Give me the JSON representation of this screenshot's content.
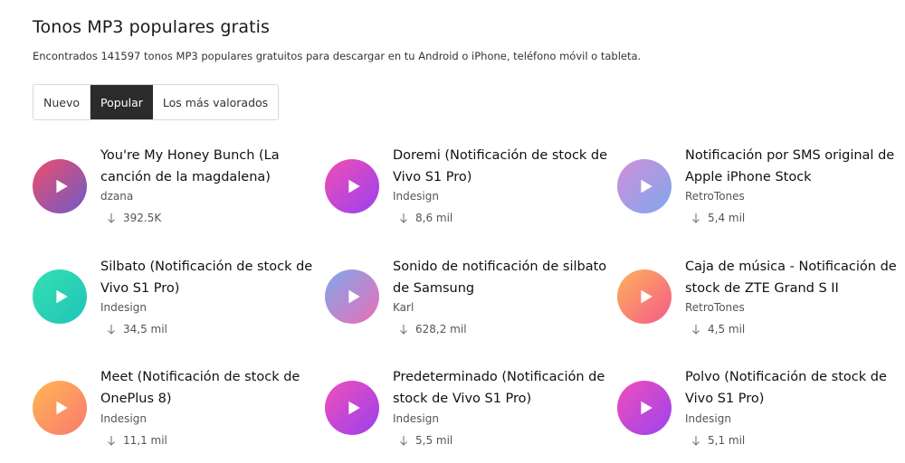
{
  "header": {
    "title": "Tonos MP3 populares gratis",
    "subtitle": "Encontrados 141597 tonos MP3 populares gratuitos para descargar en tu Android o iPhone, teléfono móvil o tableta."
  },
  "tabs": [
    {
      "label": "Nuevo",
      "active": false
    },
    {
      "label": "Popular",
      "active": true
    },
    {
      "label": "Los más valorados",
      "active": false
    }
  ],
  "icons": {
    "play": "play-icon",
    "download": "download-arrow-icon"
  },
  "ringtones": [
    {
      "name": "You're My Honey Bunch (La canción de la magdalena)",
      "author": "dzana",
      "downloads": "392.5K"
    },
    {
      "name": "Doremi (Notificación de stock de Vivo S1 Pro)",
      "author": "Indesign",
      "downloads": "8,6 mil"
    },
    {
      "name": "Notificación por SMS original de Apple iPhone Stock",
      "author": "RetroTones",
      "downloads": "5,4 mil"
    },
    {
      "name": "Silbato (Notificación de stock de Vivo S1 Pro)",
      "author": "Indesign",
      "downloads": "34,5 mil"
    },
    {
      "name": "Sonido de notificación de silbato de Samsung",
      "author": "Karl",
      "downloads": "628,2 mil"
    },
    {
      "name": "Caja de música - Notificación de stock de ZTE Grand S II",
      "author": "RetroTones",
      "downloads": "4,5 mil"
    },
    {
      "name": "Meet (Notificación de stock de OnePlus 8)",
      "author": "Indesign",
      "downloads": "11,1 mil"
    },
    {
      "name": "Predeterminado (Notificación de stock de Vivo S1 Pro)",
      "author": "Indesign",
      "downloads": "5,5 mil"
    },
    {
      "name": "Polvo (Notificación de stock de Vivo S1 Pro)",
      "author": "Indesign",
      "downloads": "5,1 mil"
    }
  ]
}
